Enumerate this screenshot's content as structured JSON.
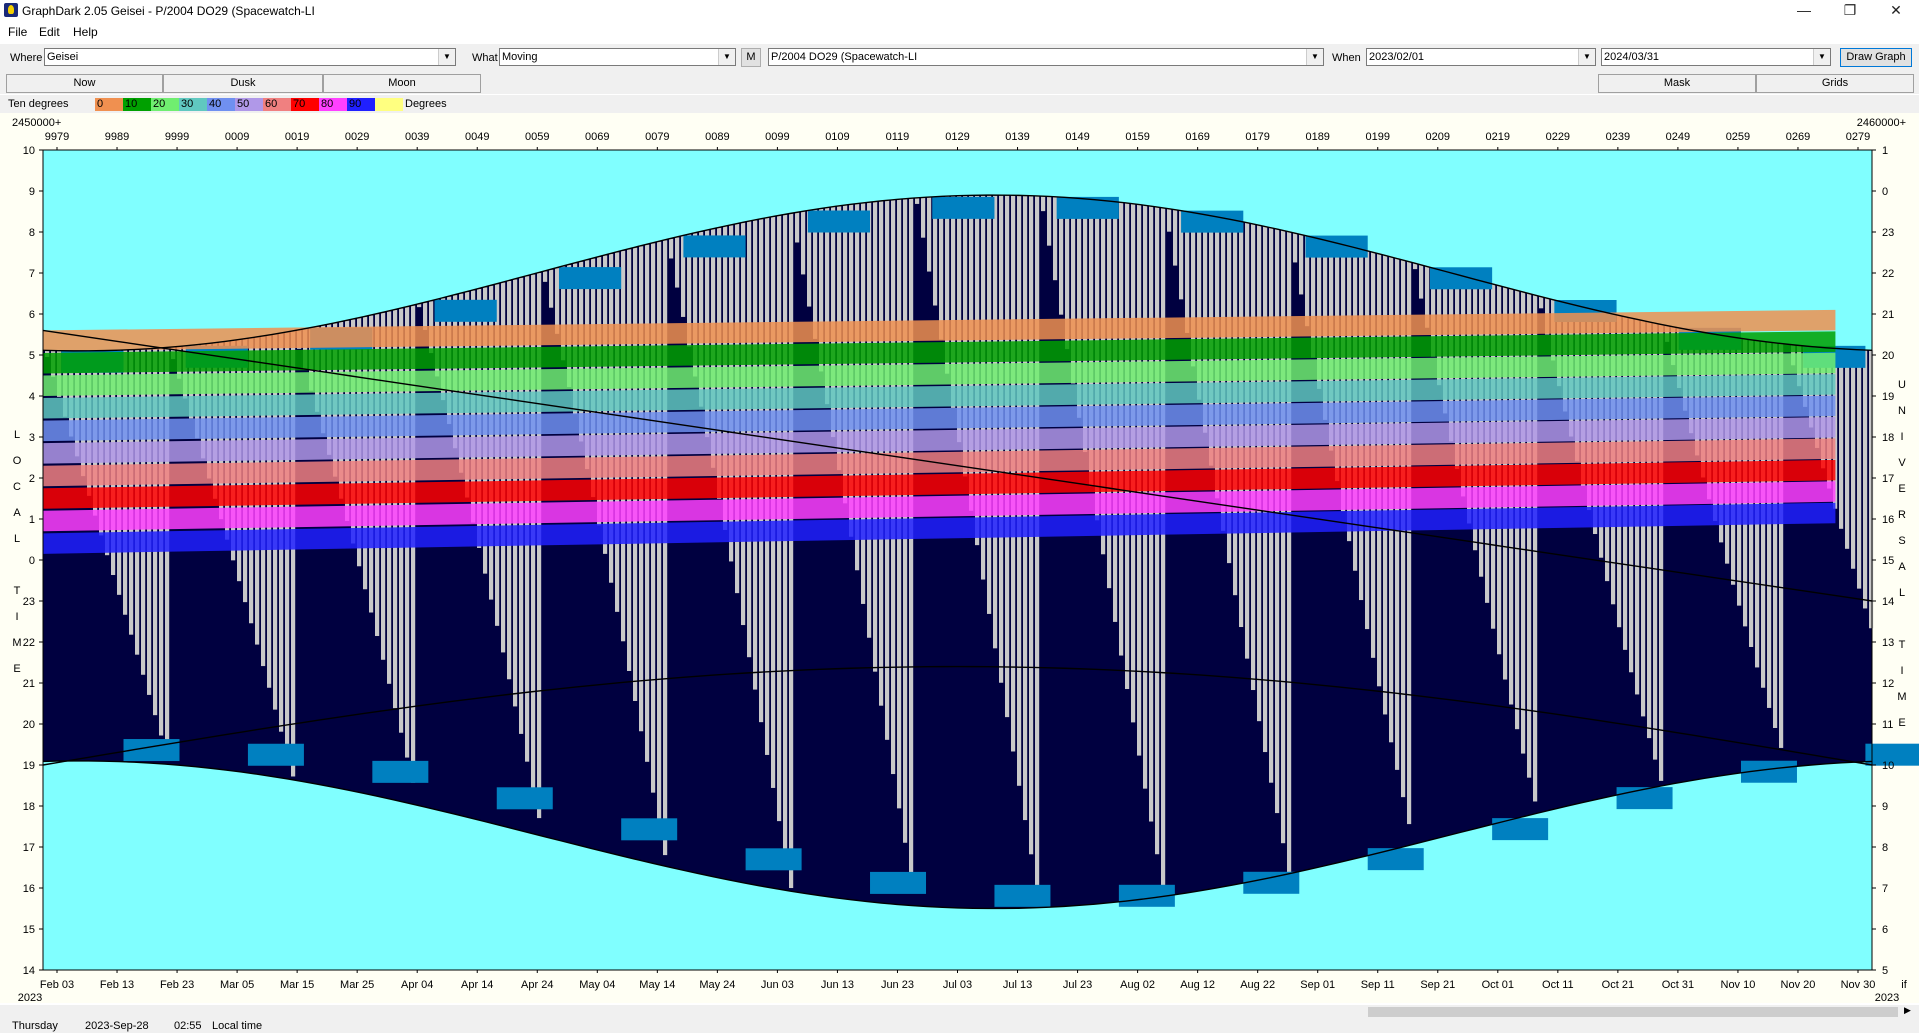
{
  "window": {
    "title": "GraphDark 2.05  Geisei  -  P/2004 DO29 (Spacewatch-LI",
    "minimize": "—",
    "maximize": "❐",
    "close": "✕"
  },
  "menu": [
    "File",
    "Edit",
    "Help"
  ],
  "toolbar": {
    "where_label": "Where",
    "where_value": "Geisei",
    "what_label": "What",
    "what_value": "Moving",
    "m_button": "M",
    "object_value": "P/2004 DO29 (Spacewatch-LI",
    "when_label": "When",
    "start_date": "2023/02/01",
    "end_date": "2024/03/31",
    "draw_button": "Draw Graph"
  },
  "buttons": {
    "now": "Now",
    "dusk": "Dusk",
    "moon": "Moon",
    "mask": "Mask",
    "grids": "Grids"
  },
  "legend": {
    "left_label": "Ten degrees",
    "right_label": "Degrees",
    "segments": [
      {
        "label": "0",
        "color": "#f09050"
      },
      {
        "label": "10",
        "color": "#00a000"
      },
      {
        "label": "20",
        "color": "#70ee70"
      },
      {
        "label": "30",
        "color": "#60c8c0"
      },
      {
        "label": "40",
        "color": "#7090f0"
      },
      {
        "label": "50",
        "color": "#b098e8"
      },
      {
        "label": "60",
        "color": "#f08080"
      },
      {
        "label": "70",
        "color": "#ff0000"
      },
      {
        "label": "80",
        "color": "#ff40ff"
      },
      {
        "label": "90",
        "color": "#2020ff"
      },
      {
        "label": "",
        "color": "#ffff80"
      }
    ]
  },
  "chart": {
    "jd_prefix_left": "2450000+",
    "jd_prefix_right": "2460000+",
    "jd_ticks": [
      "9979",
      "9989",
      "9999",
      "0009",
      "0019",
      "0029",
      "0039",
      "0049",
      "0059",
      "0069",
      "0079",
      "0089",
      "0099",
      "0109",
      "0119",
      "0129",
      "0139",
      "0149",
      "0159",
      "0169",
      "0179",
      "0189",
      "0199",
      "0209",
      "0219",
      "0229",
      "0239",
      "0249",
      "0259",
      "0269",
      "0279"
    ],
    "date_ticks": [
      "Feb 03",
      "Feb 13",
      "Feb 23",
      "Mar 05",
      "Mar 15",
      "Mar 25",
      "Apr 04",
      "Apr 14",
      "Apr 24",
      "May 04",
      "May 14",
      "May 24",
      "Jun 03",
      "Jun 13",
      "Jun 23",
      "Jul 03",
      "Jul 13",
      "Jul 23",
      "Aug 02",
      "Aug 12",
      "Aug 22",
      "Sep 01",
      "Sep 11",
      "Sep 21",
      "Oct 01",
      "Oct 11",
      "Oct 21",
      "Oct 31",
      "Nov 10",
      "Nov 20",
      "Nov 30"
    ],
    "year_left": "2023",
    "year_right": "2023",
    "right_corner": "if",
    "left_hours": [
      "10",
      "9",
      "8",
      "7",
      "6",
      "5",
      "4",
      "3",
      "2",
      "1",
      "0",
      "23",
      "22",
      "21",
      "20",
      "19",
      "18",
      "17",
      "16",
      "15",
      "14"
    ],
    "right_hours": [
      "1",
      "0",
      "23",
      "22",
      "21",
      "20",
      "19",
      "18",
      "17",
      "16",
      "15",
      "14",
      "13",
      "12",
      "11",
      "10",
      "9",
      "8",
      "7",
      "6",
      "5"
    ],
    "left_axis_title": [
      "L",
      "O",
      "C",
      "A",
      "L",
      "",
      "T",
      "I",
      "M",
      "E"
    ],
    "right_axis_title": [
      "U",
      "N",
      "I",
      "V",
      "E",
      "R",
      "S",
      "A",
      "L",
      "",
      "T",
      "I",
      "M",
      "E"
    ],
    "colors": {
      "day": "#80ffff",
      "night": "#000040",
      "moon_grey": "#c8c8c8",
      "twilight_blue": "#0080c0"
    }
  },
  "status": {
    "day": "Thursday",
    "date": "2023-Sep-28",
    "time": "02:55",
    "mode": "Local time"
  }
}
